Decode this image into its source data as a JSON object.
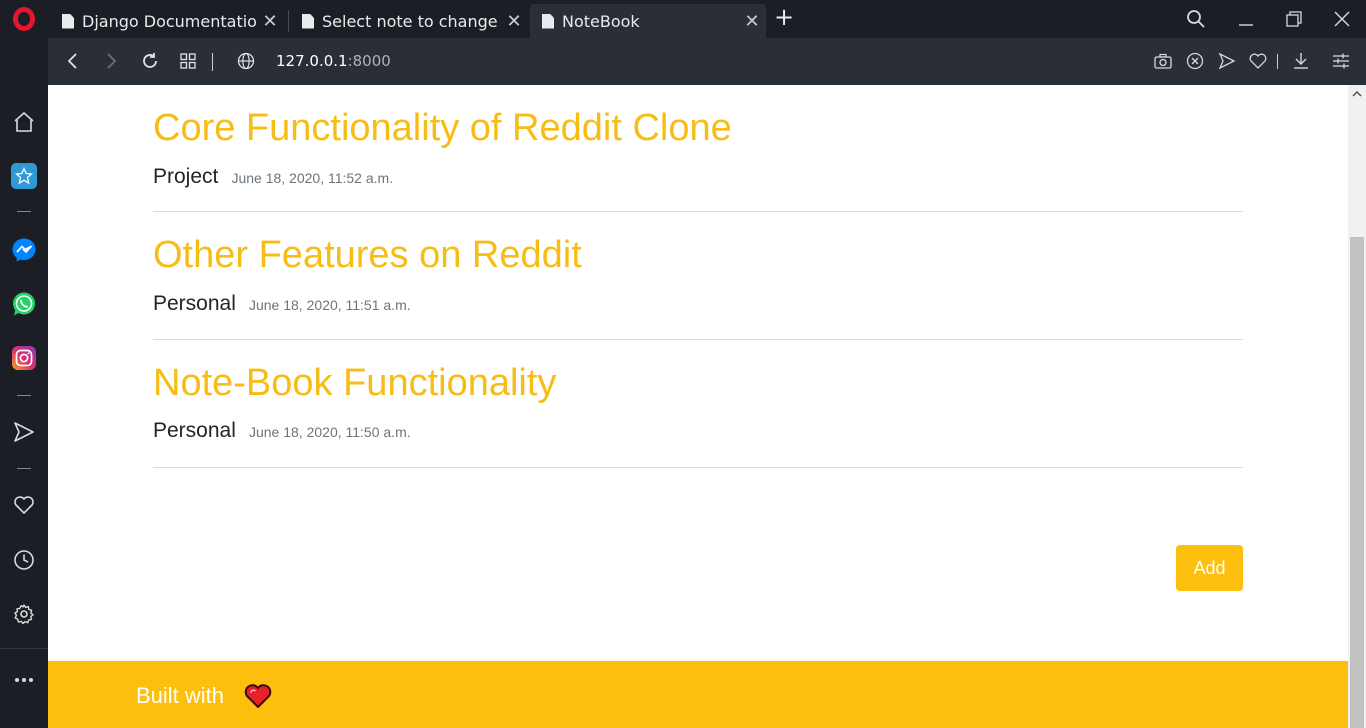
{
  "browser": {
    "tabs": [
      {
        "title": "Django Documentation",
        "active": false
      },
      {
        "title": "Select note to change | Django site admin",
        "active": false
      },
      {
        "title": "NoteBook",
        "active": true
      }
    ],
    "new_tab_symbol": "+",
    "url_host": "127.0.0.1",
    "url_port": ":8000",
    "sidebar_icons": [
      "home-icon",
      "speed-dial-icon",
      "messenger-icon",
      "whatsapp-icon",
      "instagram-icon",
      "send-icon",
      "heart-icon",
      "history-icon",
      "settings-icon",
      "more-icon"
    ],
    "colors": {
      "opera_red": "#e4152c",
      "messenger": "#0084ff",
      "whatsapp": "#25d366",
      "instagram": "#c13584",
      "speed_dial": "#2e9bd6"
    }
  },
  "notes": [
    {
      "title": "Core Functionality of Reddit Clone",
      "category": "Project",
      "date": "June 18, 2020, 11:52 a.m."
    },
    {
      "title": "Other Features on Reddit",
      "category": "Personal",
      "date": "June 18, 2020, 11:51 a.m."
    },
    {
      "title": "Note-Book Functionality",
      "category": "Personal",
      "date": "June 18, 2020, 11:50 a.m."
    }
  ],
  "add_button_label": "Add",
  "footer": {
    "text": "Built with"
  },
  "theme": {
    "accent": "#fcbf0d",
    "title_color": "#f7bd14"
  }
}
